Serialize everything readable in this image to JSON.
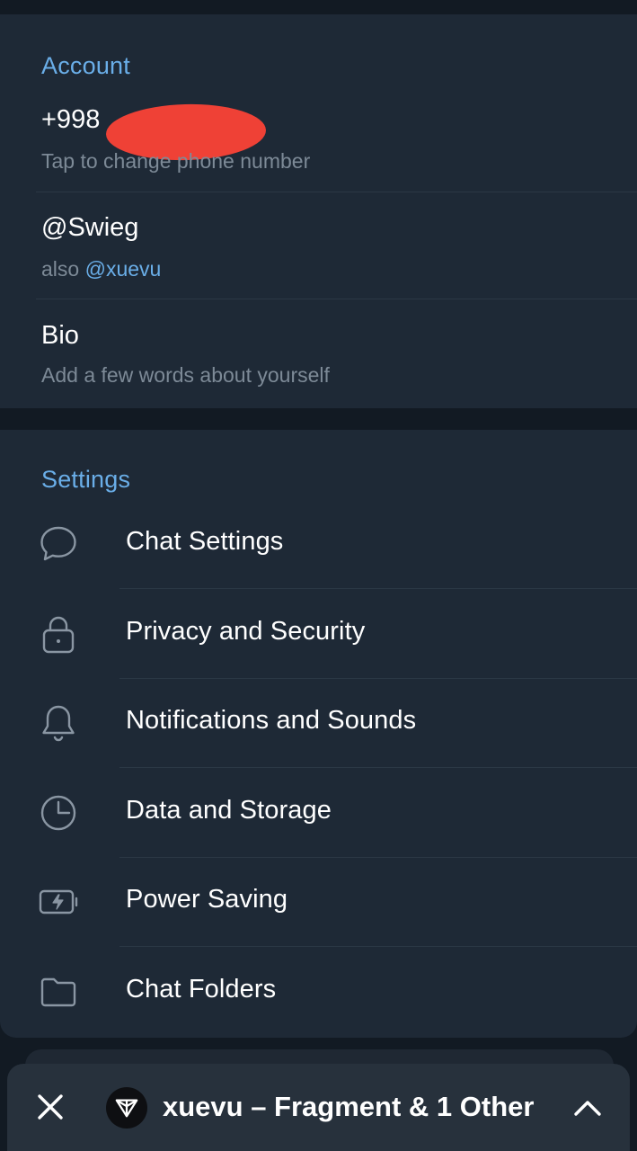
{
  "account": {
    "title": "Account",
    "phone": "+998",
    "phone_hint": "Tap to change phone number",
    "username": "@Swieg",
    "also_prefix": "also ",
    "also_username": "@xuevu",
    "bio_label": "Bio",
    "bio_hint": "Add a few words about yourself"
  },
  "settings": {
    "title": "Settings",
    "items": [
      {
        "label": "Chat Settings",
        "icon": "chat-bubble-icon"
      },
      {
        "label": "Privacy and Security",
        "icon": "lock-icon"
      },
      {
        "label": "Notifications and Sounds",
        "icon": "bell-icon"
      },
      {
        "label": "Data and Storage",
        "icon": "pie-chart-icon"
      },
      {
        "label": "Power Saving",
        "icon": "battery-bolt-icon"
      },
      {
        "label": "Chat Folders",
        "icon": "folder-icon"
      }
    ]
  },
  "banner": {
    "text": "xuevu – Fragment & 1 Other"
  },
  "colors": {
    "accent": "#6aaee8",
    "card": "#1e2936",
    "background": "#121a23",
    "redaction": "#ef4136"
  }
}
